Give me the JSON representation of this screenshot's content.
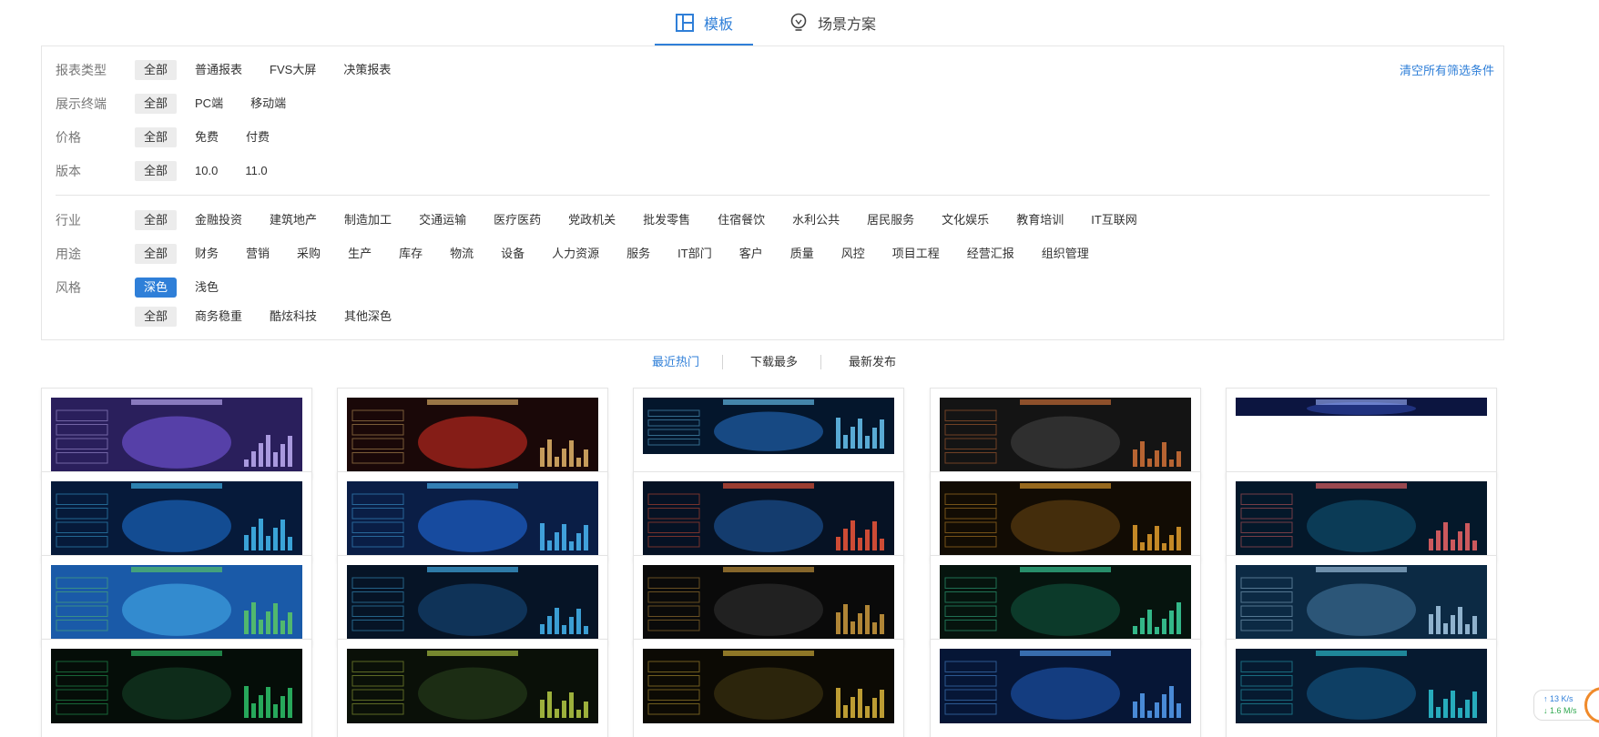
{
  "tabs": [
    {
      "label": "模板",
      "icon": "template-grid-icon",
      "active": true
    },
    {
      "label": "场景方案",
      "icon": "lightbulb-icon",
      "active": false
    }
  ],
  "filters": {
    "clear_label": "清空所有筛选条件",
    "report_type": {
      "label": "报表类型",
      "options": [
        "全部",
        "普通报表",
        "FVS大屏",
        "决策报表"
      ]
    },
    "terminal": {
      "label": "展示终端",
      "options": [
        "全部",
        "PC端",
        "移动端"
      ]
    },
    "price": {
      "label": "价格",
      "options": [
        "全部",
        "免费",
        "付费"
      ]
    },
    "version": {
      "label": "版本",
      "options": [
        "全部",
        "10.0",
        "11.0"
      ]
    },
    "industry": {
      "label": "行业",
      "options": [
        "全部",
        "金融投资",
        "建筑地产",
        "制造加工",
        "交通运输",
        "医疗医药",
        "党政机关",
        "批发零售",
        "住宿餐饮",
        "水利公共",
        "居民服务",
        "文化娱乐",
        "教育培训",
        "IT互联网"
      ]
    },
    "usage": {
      "label": "用途",
      "options": [
        "全部",
        "财务",
        "营销",
        "采购",
        "生产",
        "库存",
        "物流",
        "设备",
        "人力资源",
        "服务",
        "IT部门",
        "客户",
        "质量",
        "风控",
        "项目工程",
        "经营汇报",
        "组织管理"
      ]
    },
    "style": {
      "label": "风格",
      "options": [
        "深色",
        "浅色"
      ]
    },
    "style_sub": {
      "options": [
        "全部",
        "商务稳重",
        "酷炫科技",
        "其他深色"
      ]
    }
  },
  "sort": [
    "最近热门",
    "下载最多",
    "最新发布"
  ],
  "colors": {
    "accent": "#2f7fd8",
    "chip_bg": "#ececec"
  },
  "netspeed": {
    "up": "↑ 13 K/s",
    "down": "↓ 1.6 M/s"
  }
}
